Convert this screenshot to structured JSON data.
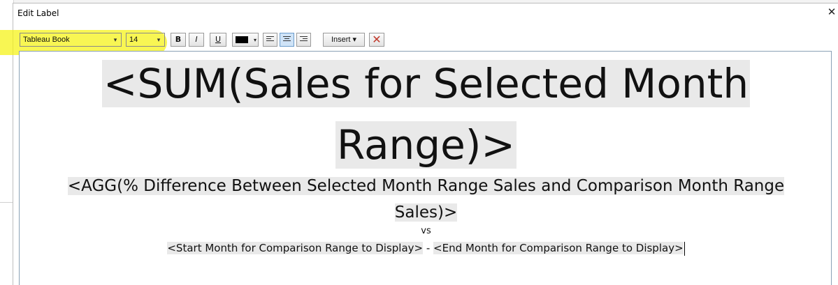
{
  "dialog": {
    "title": "Edit Label",
    "close_glyph": "✕"
  },
  "toolbar": {
    "font_family": "Tableau Book",
    "font_size": "14",
    "bold_label": "B",
    "italic_label": "I",
    "underline_label": "U",
    "text_color": "#000000",
    "align_left_icon": "align-left-icon",
    "align_center_icon": "align-center-icon",
    "align_right_icon": "align-right-icon",
    "active_alignment": "center",
    "insert_label": "Insert ▾",
    "remove_icon": "✕",
    "highlight_color": "#f6f31a"
  },
  "editor": {
    "line1a": "<SUM(Sales for Selected Month",
    "line1b": "Range)>",
    "line2a": "<AGG(% Difference Between Selected Month Range Sales and Comparison Month Range",
    "line2b": "Sales)>",
    "vs": "vs",
    "start_field": "<Start Month for Comparison Range to Display>",
    "separator": " - ",
    "end_field": "<End Month for Comparison Range to Display>"
  }
}
